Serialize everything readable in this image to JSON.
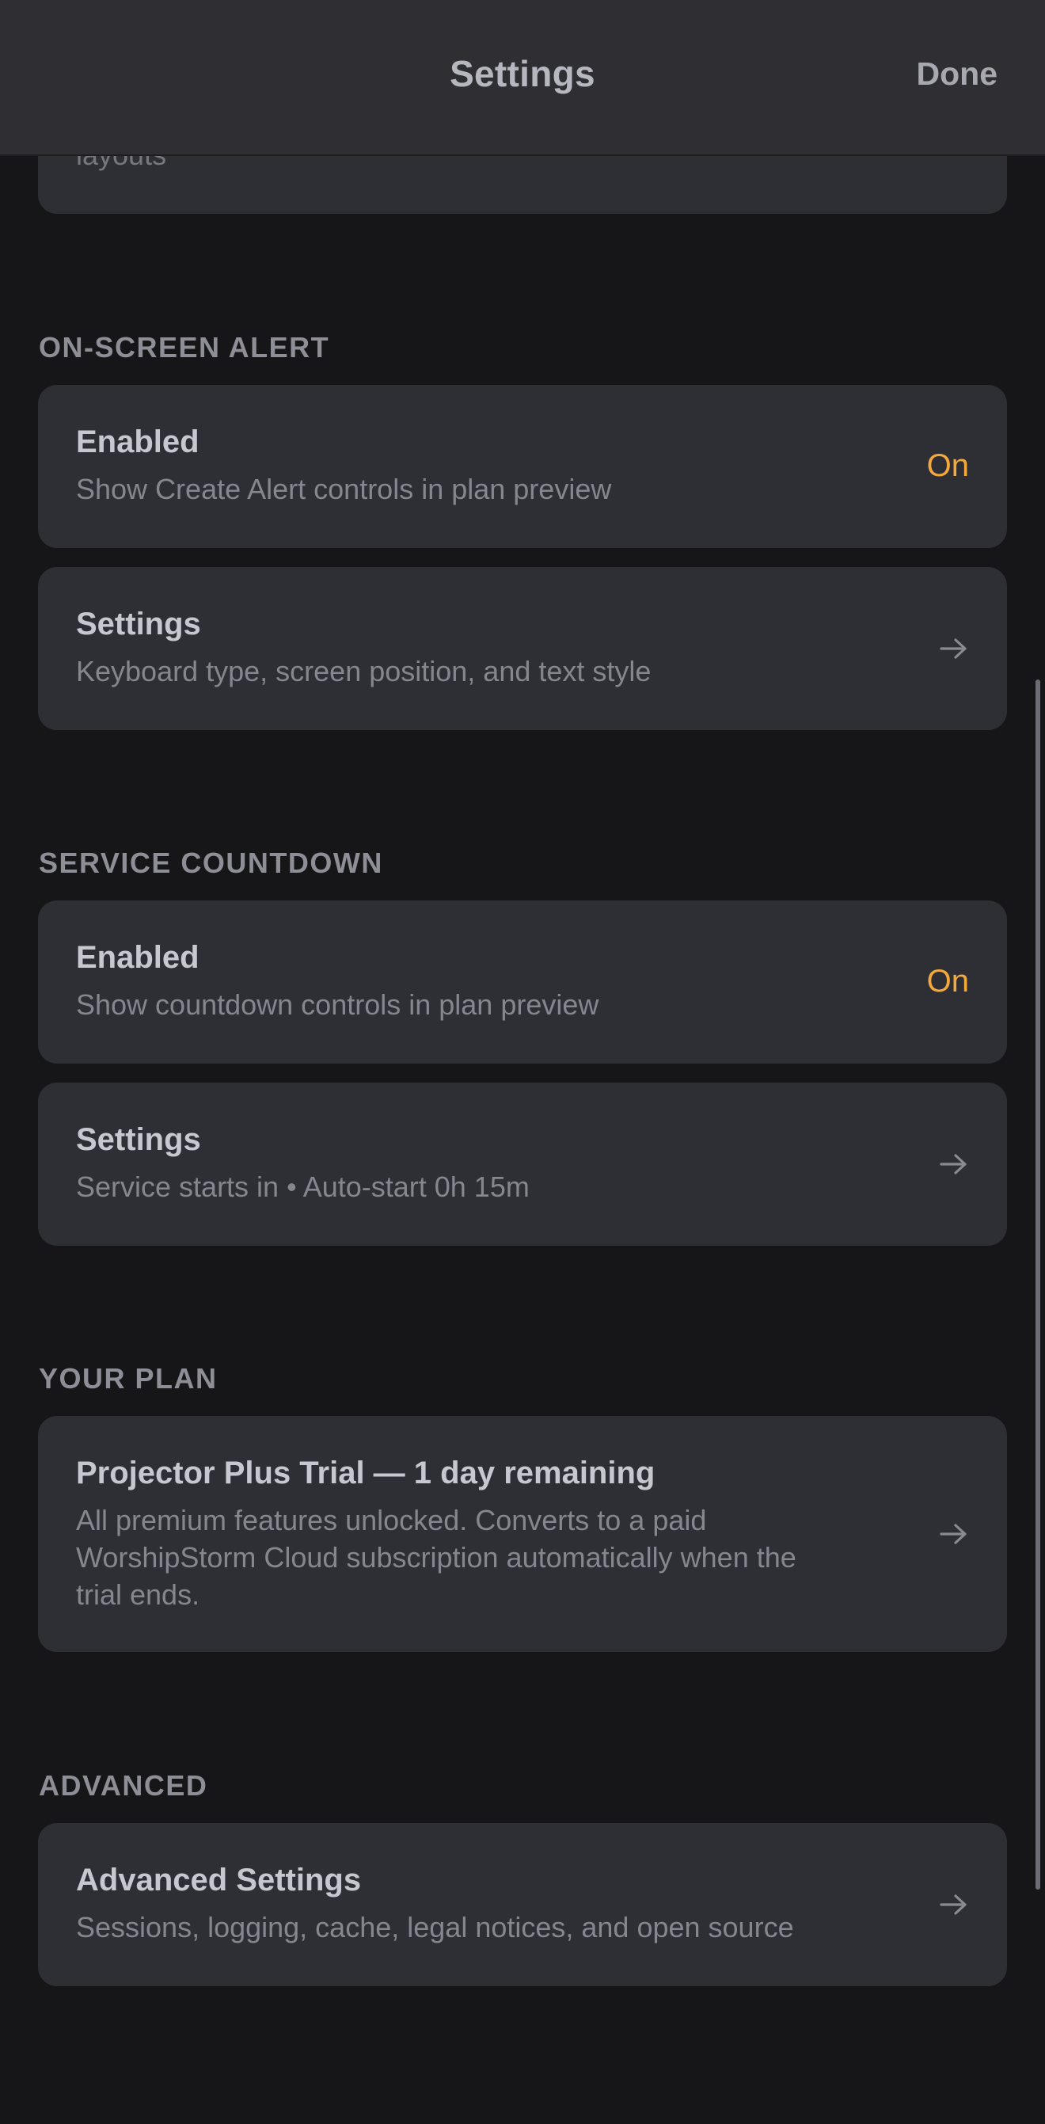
{
  "header": {
    "title": "Settings",
    "done_label": "Done"
  },
  "partial": {
    "text": "layouts"
  },
  "sections": {
    "alert": {
      "header": "ON-SCREEN ALERT",
      "enabled": {
        "title": "Enabled",
        "subtitle": "Show Create Alert controls in plan preview",
        "value": "On"
      },
      "settings": {
        "title": "Settings",
        "subtitle": "Keyboard type, screen position, and text style"
      }
    },
    "countdown": {
      "header": "SERVICE COUNTDOWN",
      "enabled": {
        "title": "Enabled",
        "subtitle": "Show countdown controls in plan preview",
        "value": "On"
      },
      "settings": {
        "title": "Settings",
        "subtitle": "Service starts in • Auto-start 0h 15m"
      }
    },
    "plan": {
      "header": "YOUR PLAN",
      "item": {
        "title": "Projector Plus Trial — 1 day remaining",
        "subtitle_line1": "All premium features unlocked. Converts to a paid",
        "subtitle_line2": "WorshipStorm Cloud subscription automatically when the",
        "subtitle_line3": "trial ends."
      }
    },
    "advanced": {
      "header": "ADVANCED",
      "item": {
        "title": "Advanced Settings",
        "subtitle": "Sessions, logging, cache, legal notices, and open source"
      }
    }
  },
  "colors": {
    "accent": "#f3a93b",
    "background": "#161618",
    "card": "#2e2e35",
    "header": "#2e2e33"
  },
  "icons": {
    "row_chevron": "arrow-right-icon"
  }
}
